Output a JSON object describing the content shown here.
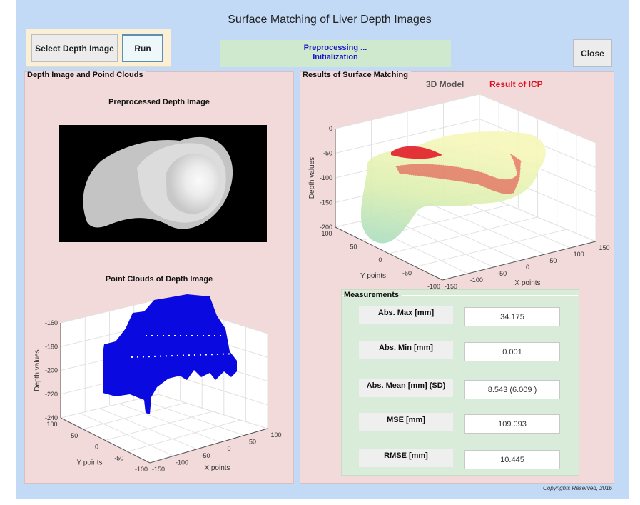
{
  "window": {
    "title": "Surface Matching of Liver Depth Images",
    "background": "#c3daf6"
  },
  "toolbar": {
    "select_label": "Select Depth Image",
    "run_label": "Run",
    "close_label": "Close"
  },
  "status": {
    "line1": "Preprocessing ...",
    "line2": "Initialization",
    "color": "#1a1acc"
  },
  "left_panel": {
    "title": "Depth Image and Poind Clouds",
    "image_title": "Preprocessed Depth Image",
    "cloud_title": "Point Clouds of Depth Image"
  },
  "right_panel": {
    "title": "Results of Surface Matching",
    "legend": [
      {
        "label": "3D Model",
        "color": "#555555"
      },
      {
        "label": "Result of ICP",
        "color": "#e01020"
      }
    ]
  },
  "chart_data": [
    {
      "type": "scatter3d",
      "title": "Point Clouds of Depth Image",
      "xlabel": "X points",
      "ylabel": "Y points",
      "zlabel": "Depth values",
      "xticks": [
        "-150",
        "-100",
        "-50",
        "0",
        "50",
        "100"
      ],
      "yticks": [
        "100",
        "50",
        "0",
        "-50",
        "-100"
      ],
      "zticks": [
        "-160",
        "-180",
        "-200",
        "-220",
        "-240"
      ],
      "xlim": [
        -150,
        100
      ],
      "ylim": [
        -100,
        100
      ],
      "zlim": [
        -240,
        -160
      ],
      "grid": true,
      "series": [
        {
          "color": "#0a0ae0"
        }
      ]
    },
    {
      "type": "surface3d",
      "xlabel": "X points",
      "ylabel": "Y points",
      "zlabel": "Depth values",
      "xticks": [
        "-150",
        "-100",
        "-50",
        "0",
        "50",
        "100",
        "150"
      ],
      "yticks": [
        "100",
        "50",
        "0",
        "-50",
        "-100"
      ],
      "zticks": [
        "0",
        "-50",
        "-100",
        "-150",
        "-200"
      ],
      "xlim": [
        -150,
        150
      ],
      "ylim": [
        -100,
        100
      ],
      "zlim": [
        -200,
        0
      ],
      "grid": true,
      "series": [
        {
          "name": "3D Model",
          "color": "#e6f0a0"
        },
        {
          "name": "Result of ICP",
          "color": "#e01020"
        }
      ],
      "legend_position": "top"
    }
  ],
  "measurements": {
    "title": "Measurements",
    "rows": [
      {
        "label": "Abs. Max [mm]",
        "value": "34.175"
      },
      {
        "label": "Abs. Min [mm]",
        "value": "0.001"
      },
      {
        "label": "Abs. Mean [mm] (SD)",
        "value": "8.543 (6.009 )"
      },
      {
        "label": "MSE [mm]",
        "value": "109.093"
      },
      {
        "label": "RMSE [mm]",
        "value": "10.445"
      }
    ]
  },
  "footer": {
    "copyright": "Copyrights Reserved, 2016"
  }
}
